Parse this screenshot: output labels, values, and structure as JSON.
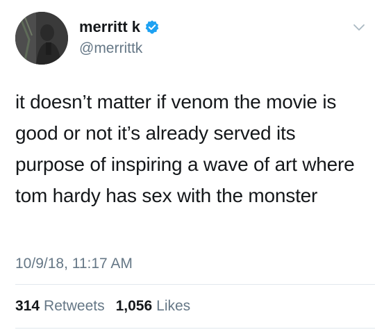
{
  "tweet": {
    "author": {
      "display_name": "merritt k",
      "handle": "@merrittk",
      "verified": true
    },
    "text": "it doesn’t matter if venom the movie is good or not it’s already served its purpose of inspiring a wave of art where tom hardy has sex with the monster",
    "timestamp": "10/9/18, 11:17 AM",
    "stats": {
      "retweets_count": "314",
      "retweets_label": "Retweets",
      "likes_count": "1,056",
      "likes_label": "Likes"
    }
  },
  "icons": {
    "verified": "verified-badge-icon",
    "menu": "chevron-down-icon"
  },
  "colors": {
    "verified_blue": "#1da1f2",
    "secondary_text": "#657786",
    "primary_text": "#14171a",
    "divider": "#e1e8ed"
  }
}
